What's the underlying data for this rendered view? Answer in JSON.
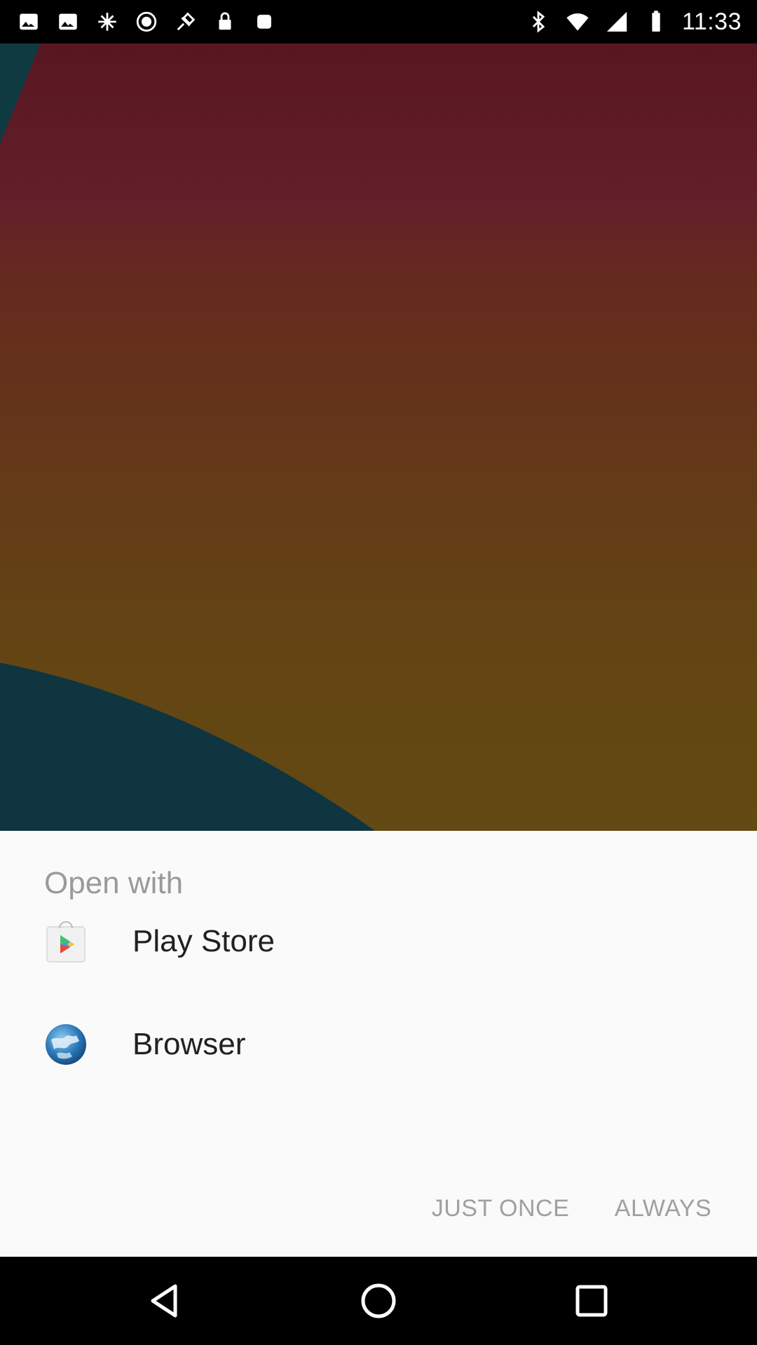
{
  "status_bar": {
    "time": "11:33",
    "left_icons": [
      "image-icon",
      "image-icon",
      "satellite-icon",
      "record-icon",
      "fake-gps-icon",
      "lock-icon",
      "square-icon"
    ],
    "right_icons": [
      "bluetooth-icon",
      "wifi-icon",
      "signal-icon",
      "battery-icon"
    ]
  },
  "dialog": {
    "title": "Open with",
    "apps": [
      {
        "label": "Play Store",
        "icon": "play-store-icon"
      },
      {
        "label": "Browser",
        "icon": "globe-icon"
      }
    ],
    "buttons": {
      "just_once": "JUST ONCE",
      "always": "ALWAYS"
    }
  },
  "nav_bar": {
    "buttons": [
      "back-icon",
      "home-icon",
      "recents-icon"
    ]
  },
  "colors": {
    "sheet_background": "#fafafa",
    "title_text": "#9a9a9a",
    "app_label_text": "#212121",
    "button_text": "#a0a0a0"
  }
}
